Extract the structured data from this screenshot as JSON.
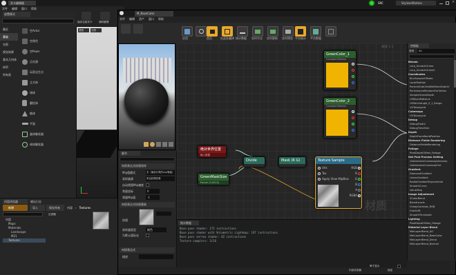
{
  "colors": {
    "accent": "#e8a92a",
    "material_yellow": "#f0b400",
    "node_green": "#1d7a3a",
    "node_teal": "#2a7c8a",
    "node_red": "#8b1a1a"
  },
  "main_window": {
    "tab_title": "关卡编辑器",
    "menu": [
      "文件",
      "编辑",
      "窗口",
      "帮助"
    ],
    "place_panel": {
      "title": "放置模式",
      "search_placeholder": "搜索类",
      "categories": [
        "最近",
        "基础",
        "光照",
        "视觉效果",
        "基本几何体",
        "体积",
        "所有类"
      ],
      "items": [
        "空Actor",
        "空角色",
        "空Pawn",
        "点光源",
        "玩家出生点",
        "立方体",
        "球体",
        "圆柱体",
        "椎体",
        "平面",
        "盒体触发器",
        "球体触发器"
      ]
    },
    "toolbar_labels": [
      "保存当前关卡",
      "源码管理"
    ],
    "viewport_tabs": [
      "透视",
      "光照"
    ]
  },
  "title_bar_right": {
    "source_control": "SRC",
    "project_name": "StylizedStation"
  },
  "content_browser": {
    "tabs": [
      "内容浏览器",
      "输出日志"
    ],
    "add_new": "新增",
    "import": "导入",
    "save_all": "保存所有",
    "path": [
      "内容",
      "Textures"
    ],
    "filter_label": "过滤器",
    "tree": [
      "内容",
      "Maps",
      "Materials",
      "Landscape",
      "M21",
      "Textures"
    ]
  },
  "material_editor": {
    "tab_title": "M_BaseColor",
    "menu": [
      "文件",
      "编辑",
      "资产",
      "窗口",
      "帮助"
    ],
    "toolbar": [
      "保存",
      "浏览",
      "应用",
      "搜索",
      "首页",
      "在此处编译",
      "统计数据",
      "实时节点",
      "实时更新",
      "实时预览",
      "隐藏未使用",
      "平台统计",
      "平台数据"
    ],
    "zoom": "缩放 1:1",
    "watermark": "材质",
    "nodes": {
      "green_color_1_title": "GreenColor_1",
      "green_color_1_sub": "Constant3Vector",
      "green_color_2_title": "GreenColor_2",
      "green_color_2_sub": "Constant3Vector",
      "world_position_title": "绝对世界位置",
      "world_position_sub": "输入数据",
      "green_mask_title": "GreenMaskSize",
      "green_mask_sub": "Param (0.0015)",
      "divide_title": "Divide",
      "mask_title": "Mask (R G)",
      "texture_sample_title": "Texture Sample",
      "uvs_pin": "UVs",
      "tex_pin": "Tex",
      "apply_view_mip": "Apply View MipBias",
      "rgb_pin": "RGB",
      "r_pin": "R",
      "g_pin": "G",
      "b_pin": "B",
      "a_pin": "A",
      "rgba_pin": "RGBA"
    },
    "details": {
      "title": "细节",
      "search_placeholder": "搜索",
      "sections": [
        "材质表达式纹理采样",
        "材质表达式纹理基础",
        "材质表达式"
      ],
      "rows": [
        {
          "label": "Mip值模式",
          "value": "无（使用计算的mip等级）"
        },
        {
          "label": "采样器源",
          "value": "来自纹理资源"
        },
        {
          "label": "自动视图Mip偏差",
          "value": ""
        },
        {
          "label": "常量坐标",
          "value": "0"
        },
        {
          "label": "常量Mip值",
          "value": "-1"
        }
      ],
      "texture_label": "纹理",
      "sampler_type_label": "采样器类型",
      "sampler_type_value": "颜色",
      "is_default_label": "为默认值标志",
      "desc_label": "描述"
    },
    "stats": {
      "title": "统计数据",
      "lines": [
        "Base pass shader: 173 instructions",
        "Base pass shader with Volumetric Lightmap: 197 instructions",
        "Base pass vertex shader: 82 instructions",
        "Texture samplers: 3/16"
      ]
    },
    "palette": {
      "title": "控制板",
      "category_label": "类别",
      "category_value": "All",
      "search_placeholder": "",
      "entries": [
        {
          "t": "h",
          "s": "Blends"
        },
        {
          "t": "i",
          "s": "Lerp_ScratchGrime"
        },
        {
          "t": "i",
          "s": "Lerp_ScratchGrime2"
        },
        {
          "t": "h",
          "s": "Coordinates"
        },
        {
          "t": "i",
          "s": "BlurSampleOffsets"
        },
        {
          "t": "i",
          "s": "LocalPosition"
        },
        {
          "t": "i",
          "s": "ParticleSubUVsWithBlendSubUV"
        },
        {
          "t": "i",
          "s": "PerInstanceRandomForVertex"
        },
        {
          "t": "i",
          "s": "SampleSceneDepth"
        },
        {
          "t": "i",
          "s": "UVBlockPatterns"
        },
        {
          "t": "i",
          "s": "UVPatchAngle_0_1_Range"
        },
        {
          "t": "i",
          "s": "UVToLongLat"
        },
        {
          "t": "h",
          "s": "Cubemaps"
        },
        {
          "t": "i",
          "s": "UVToLongLat"
        },
        {
          "t": "h",
          "s": "Debug"
        },
        {
          "t": "i",
          "s": "DebugFloat2"
        },
        {
          "t": "i",
          "s": "DebugTimeSine"
        },
        {
          "t": "h",
          "s": "Depth"
        },
        {
          "t": "i",
          "s": "DepthFromWorldPosition"
        },
        {
          "t": "h",
          "s": "Distance Fields Rendering"
        },
        {
          "t": "i",
          "s": "DistanceFieldsRendering"
        },
        {
          "t": "h",
          "s": "Foliage"
        },
        {
          "t": "i",
          "s": "PixelDepthOffset_Foliage"
        },
        {
          "t": "h",
          "s": "Get Post Process Setting"
        },
        {
          "t": "i",
          "s": "GetAmbientCubemapIntensity"
        },
        {
          "t": "i",
          "s": "GetAmbientCubemapTint"
        },
        {
          "t": "h",
          "s": "Gradient"
        },
        {
          "t": "i",
          "s": "DiamondGradient"
        },
        {
          "t": "i",
          "s": "LinearGradient"
        },
        {
          "t": "i",
          "s": "RadialGradientExponential"
        },
        {
          "t": "i",
          "s": "SmoothCurve"
        },
        {
          "t": "i",
          "s": "ValueStep"
        },
        {
          "t": "h",
          "s": "Image Adjustment"
        },
        {
          "t": "i",
          "s": "3ColorBlend"
        },
        {
          "t": "i",
          "s": "BlendLevels"
        },
        {
          "t": "i",
          "s": "CheapContrast_RGB"
        },
        {
          "t": "i",
          "s": "HueShift"
        },
        {
          "t": "i",
          "s": "SmoothThreshold"
        },
        {
          "t": "h",
          "s": "Lighting"
        },
        {
          "t": "i",
          "s": "PixelDepthOffset_Foliage"
        },
        {
          "t": "h",
          "s": "Material Layer Blend"
        },
        {
          "t": "i",
          "s": "MatLayerBlend_AO"
        },
        {
          "t": "i",
          "s": "MatLayerBlend_BaseColor"
        },
        {
          "t": "i",
          "s": "MatLayerBlend_Decal"
        },
        {
          "t": "i",
          "s": "MatLayerBlend_Normal"
        }
      ]
    },
    "bottom_right": {
      "content_browser_label": "内容浏览器",
      "lock_label": "锁定",
      "checkbox_label": "等于显示"
    }
  }
}
